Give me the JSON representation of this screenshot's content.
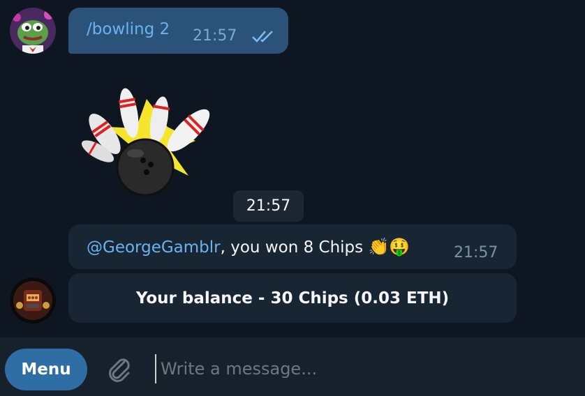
{
  "messages": {
    "command": {
      "text": "/bowling 2",
      "time": "21:57"
    },
    "dice_time": "21:57",
    "win": {
      "mention": "@GeorgeGamblr",
      "text": ", you won 8 Chips ",
      "emoji": "👏🤑",
      "time": "21:57"
    },
    "balance_button": "Your balance - 30 Chips (0.03 ETH)"
  },
  "composer": {
    "menu_label": "Menu",
    "placeholder": "Write a message..."
  },
  "colors": {
    "background": "#0e1621",
    "outgoing_bubble": "#2b5278",
    "incoming_bubble": "#182533",
    "menu_button": "#2f6ea5",
    "link": "#6ab3f3"
  }
}
